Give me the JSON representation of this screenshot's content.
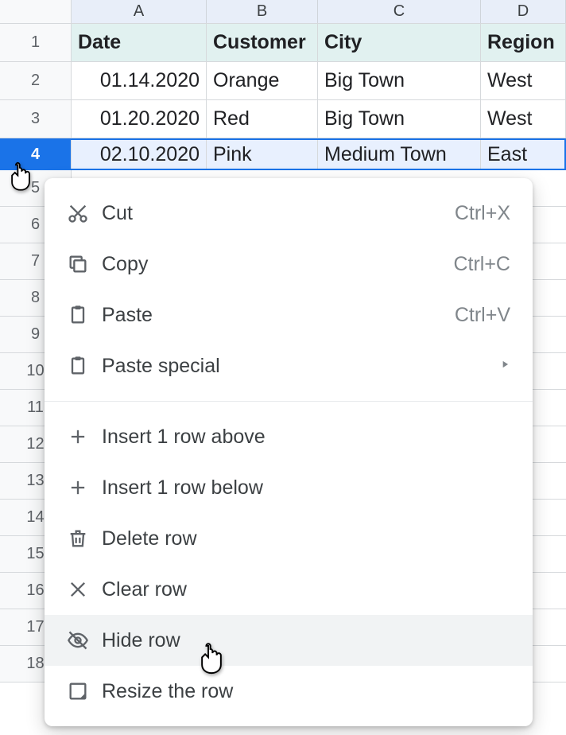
{
  "columns": {
    "A": "A",
    "B": "B",
    "C": "C",
    "D": "D"
  },
  "rows": {
    "r1": "1",
    "r2": "2",
    "r3": "3",
    "r4": "4",
    "r5": "5",
    "r6": "6",
    "r7": "7",
    "r8": "8",
    "r9": "9",
    "r10": "10",
    "r11": "11",
    "r12": "12",
    "r13": "13",
    "r14": "14",
    "r15": "15",
    "r16": "16",
    "r17": "17",
    "r18": "18"
  },
  "header_row": {
    "A": "Date",
    "B": "Customer",
    "C": "City",
    "D": "Region"
  },
  "data": {
    "r2": {
      "A": "01.14.2020",
      "B": "Orange",
      "C": "Big Town",
      "D": "West"
    },
    "r3": {
      "A": "01.20.2020",
      "B": "Red",
      "C": "Big Town",
      "D": "West"
    },
    "r4": {
      "A": "02.10.2020",
      "B": "Pink",
      "C": "Medium Town",
      "D": "East"
    }
  },
  "menu": {
    "cut": {
      "label": "Cut",
      "shortcut": "Ctrl+X"
    },
    "copy": {
      "label": "Copy",
      "shortcut": "Ctrl+C"
    },
    "paste": {
      "label": "Paste",
      "shortcut": "Ctrl+V"
    },
    "paste_special": {
      "label": "Paste special"
    },
    "insert_above": {
      "label": "Insert 1 row above"
    },
    "insert_below": {
      "label": "Insert 1 row below"
    },
    "delete_row": {
      "label": "Delete row"
    },
    "clear_row": {
      "label": "Clear row"
    },
    "hide_row": {
      "label": "Hide row"
    },
    "resize_row": {
      "label": "Resize the row"
    }
  }
}
